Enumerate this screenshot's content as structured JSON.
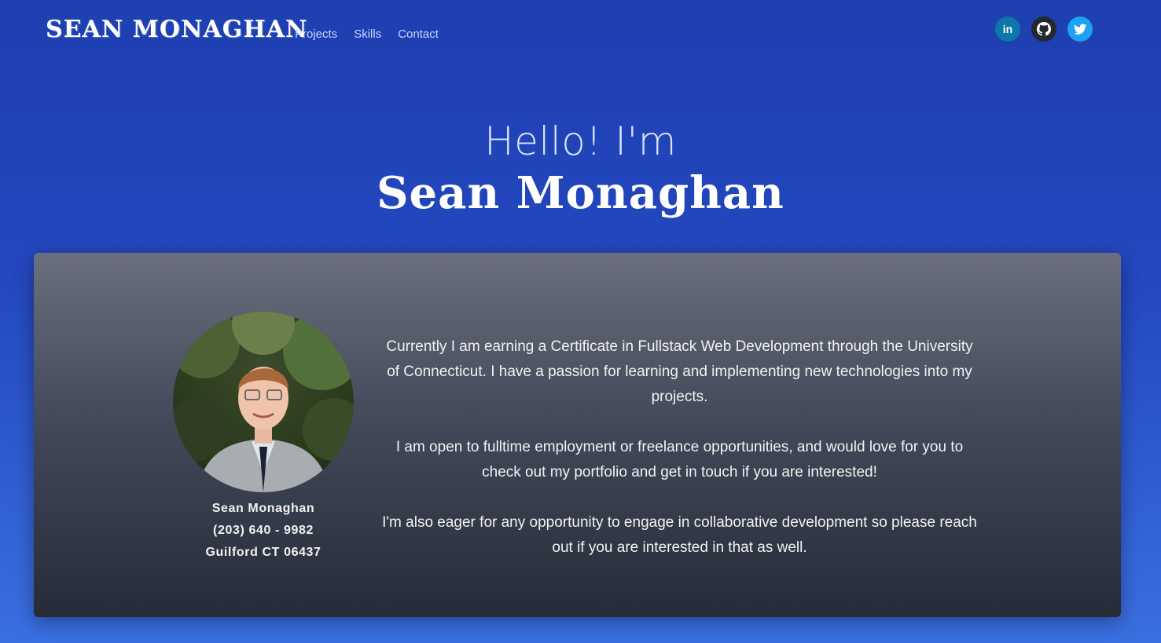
{
  "nav": {
    "brand": "SEAN MONAGHAN",
    "links": [
      "Projects",
      "Skills",
      "Contact"
    ],
    "socials": [
      {
        "name": "linkedin",
        "label": "in",
        "color": "#0e76a8"
      },
      {
        "name": "github",
        "color": "#24292e"
      },
      {
        "name": "twitter",
        "color": "#1da1f2"
      }
    ]
  },
  "hero": {
    "greeting": "Hello! I'm",
    "name": "Sean Monaghan"
  },
  "profile": {
    "name": "Sean Monaghan",
    "phone": "(203) 640 - 9982",
    "location": "Guilford CT 06437"
  },
  "about": {
    "paragraphs": [
      "Currently I am earning a Certificate in Fullstack Web Development through the University of Connecticut. I have a passion for learning and implementing new technologies into my projects.",
      "I am open to fulltime employment or freelance opportunities, and would love for you to check out my portfolio and get in touch if you are interested!",
      "I'm also eager for any opportunity to engage in collaborative development so please reach out if you are interested in that as well."
    ]
  },
  "colors": {
    "background_top": "#1e3fb0",
    "background_bottom": "#3a6fe0",
    "card_top": "#6b6f7d",
    "card_bottom": "#262b38"
  }
}
